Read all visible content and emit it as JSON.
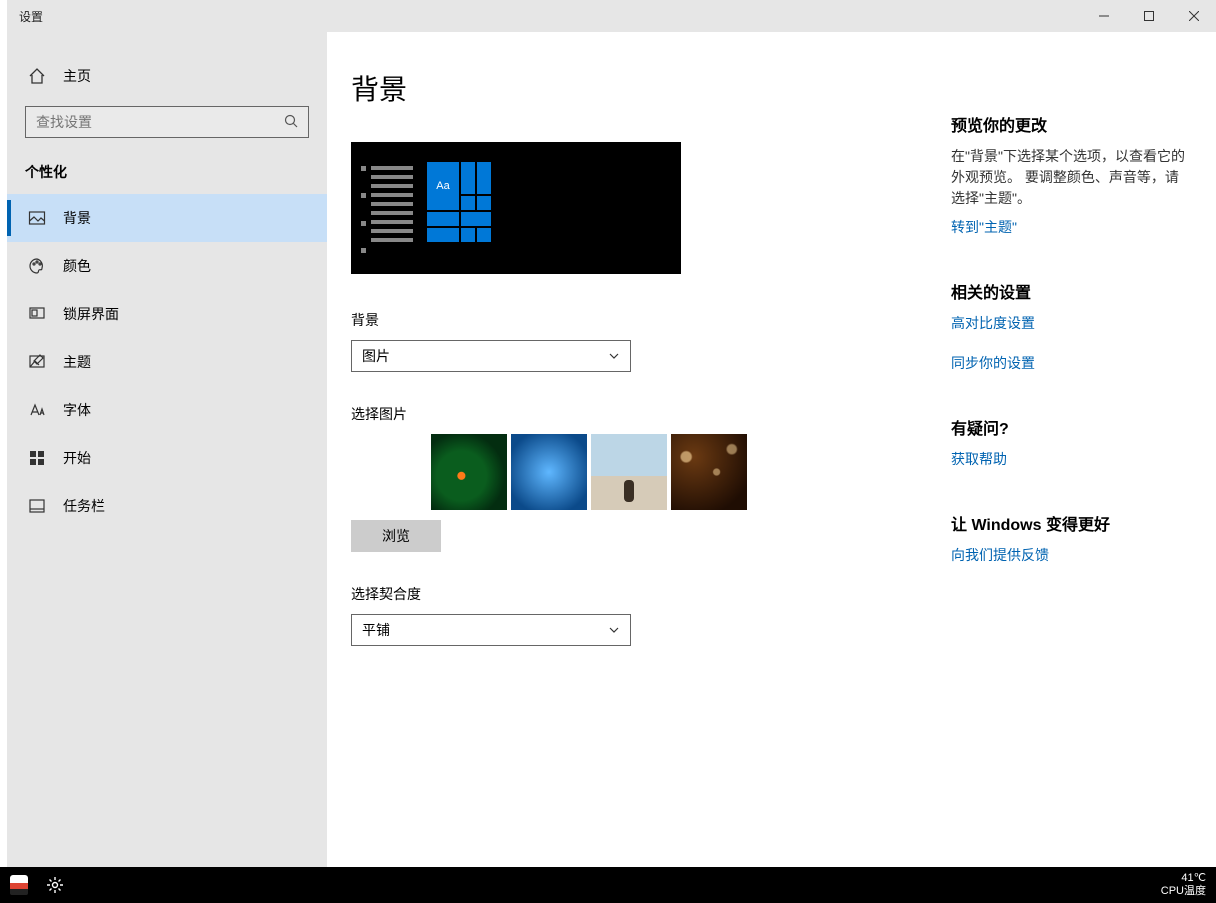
{
  "window": {
    "title": "设置"
  },
  "sidebar": {
    "home": "主页",
    "search_placeholder": "查找设置",
    "section": "个性化",
    "items": [
      {
        "icon": "picture-icon",
        "label": "背景",
        "active": true
      },
      {
        "icon": "palette-icon",
        "label": "颜色"
      },
      {
        "icon": "lockscreen-icon",
        "label": "锁屏界面"
      },
      {
        "icon": "theme-icon",
        "label": "主题"
      },
      {
        "icon": "font-icon",
        "label": "字体"
      },
      {
        "icon": "start-icon",
        "label": "开始"
      },
      {
        "icon": "taskbar-icon",
        "label": "任务栏"
      }
    ]
  },
  "main": {
    "title": "背景",
    "preview_sample_text": "Aa",
    "bg_label": "背景",
    "bg_value": "图片",
    "choose_image_label": "选择图片",
    "browse_label": "浏览",
    "fit_label": "选择契合度",
    "fit_value": "平铺"
  },
  "right": {
    "preview_heading": "预览你的更改",
    "preview_text": "在\"背景\"下选择某个选项，以查看它的外观预览。 要调整颜色、声音等，请选择\"主题\"。",
    "theme_link": "转到\"主题\"",
    "related_heading": "相关的设置",
    "related_link1": "高对比度设置",
    "related_link2": "同步你的设置",
    "question_heading": "有疑问?",
    "question_link": "获取帮助",
    "feedback_heading": "让 Windows 变得更好",
    "feedback_link": "向我们提供反馈"
  },
  "taskbar": {
    "temp": "41℃",
    "temp_label": "CPU温度"
  }
}
